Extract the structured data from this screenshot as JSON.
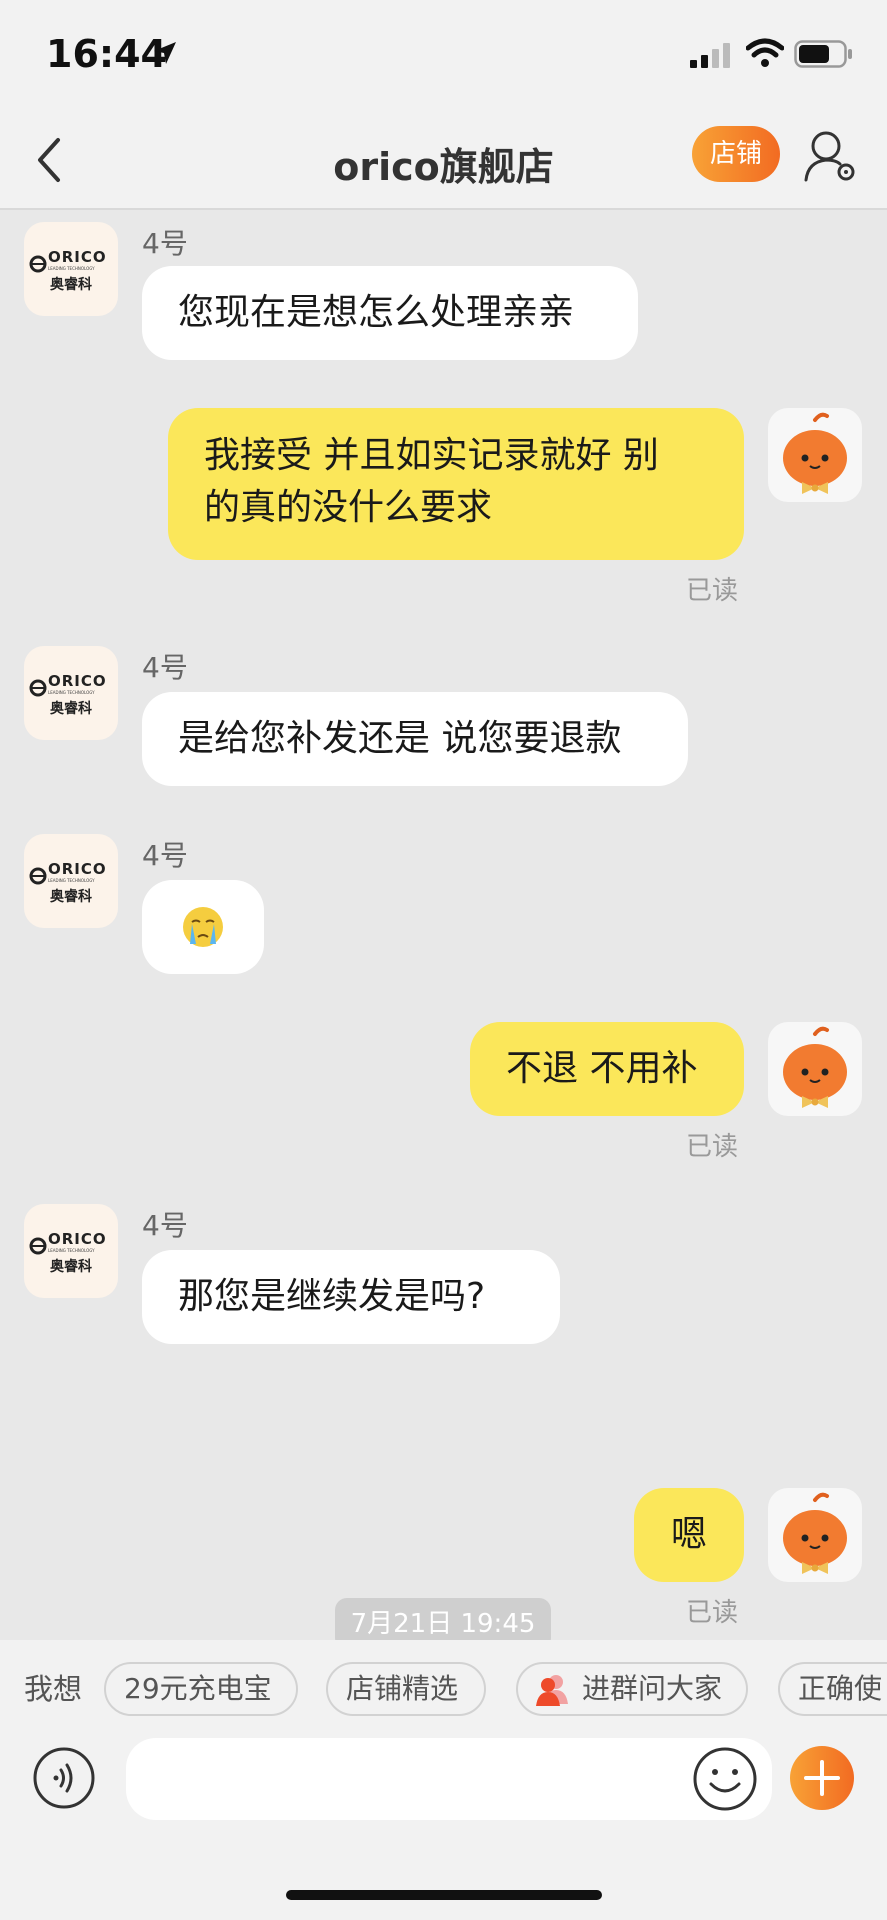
{
  "status_bar": {
    "time": "16:44"
  },
  "header": {
    "title": "orico旗舰店",
    "shop_button": "店铺"
  },
  "shop_avatar": {
    "brand": "ORICO",
    "tagline": "LEADING TECHNOLOGY",
    "cn_name": "奥睿科"
  },
  "messages": [
    {
      "from": "shop",
      "sender": "4号",
      "text": "您现在是想怎么处理亲亲"
    },
    {
      "from": "me",
      "lines": [
        "我接受 并且如实记录就好 别",
        "的真的没什么要求"
      ],
      "status": "已读"
    },
    {
      "from": "shop",
      "sender": "4号",
      "text": "是给您补发还是 说您要退款"
    },
    {
      "from": "shop",
      "sender": "4号",
      "emoji": "crying-face"
    },
    {
      "from": "me",
      "text": "不退 不用补",
      "status": "已读"
    },
    {
      "from": "shop",
      "sender": "4号",
      "text": "那您是继续发是吗?"
    },
    {
      "from": "me",
      "text": "嗯",
      "status": "已读"
    }
  ],
  "timestamp": "7月21日 19:45",
  "quick_replies": {
    "label": "我想",
    "items": [
      "29元充电宝",
      "店铺精选",
      "进群问大家",
      "正确使"
    ]
  },
  "colors": {
    "accent": "#f26b22",
    "my_bubble": "#fbe75a",
    "shop_bubble": "#ffffff",
    "background": "#e8e8e8"
  }
}
